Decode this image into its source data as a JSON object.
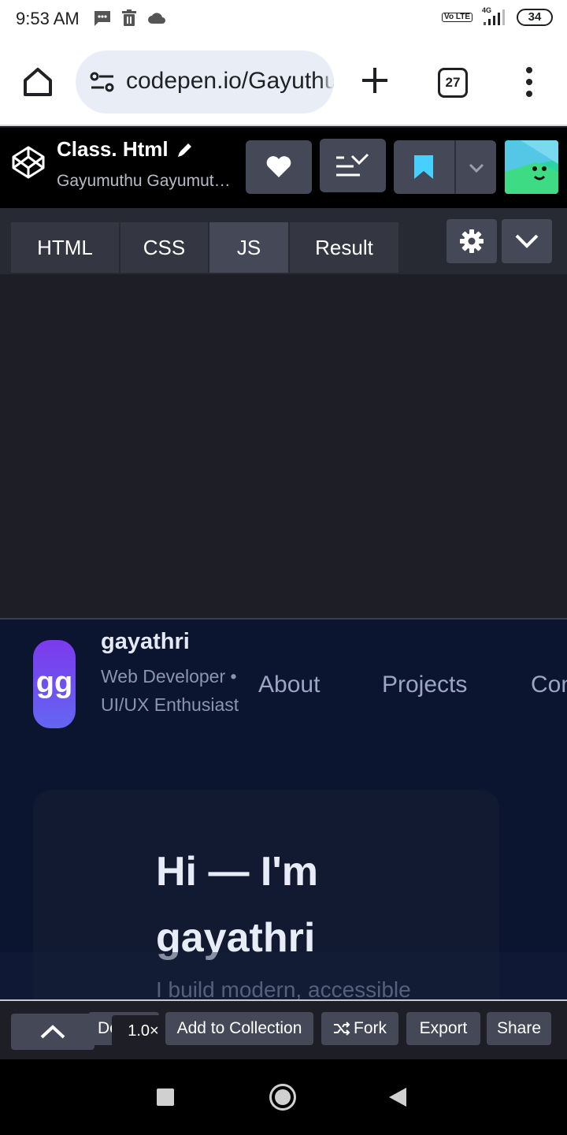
{
  "status_bar": {
    "time": "9:53 AM",
    "network": "4G",
    "volte": "Vo LTE",
    "battery": "34"
  },
  "browser": {
    "url": "codepen.io/Gayuthu",
    "tab_count": "27"
  },
  "codepen_header": {
    "title": "Class. Html",
    "author": "Gayumuthu Gayumuthu"
  },
  "editor_tabs": [
    "HTML",
    "CSS",
    "JS",
    "Result"
  ],
  "active_tab": "JS",
  "preview": {
    "logo_text": "gg",
    "name": "gayathri",
    "tagline": "Web Developer • UI/UX Enthusiast",
    "nav": [
      "About",
      "Projects",
      "Contact"
    ],
    "hero_title": "Hi — I'm gayathri",
    "hero_subtitle": "I build modern, accessible"
  },
  "toolbar": {
    "delete_label": "Delete",
    "zoom": "1.0×",
    "add_to_collection": "Add to Collection",
    "fork": "Fork",
    "export": "Export",
    "share": "Share"
  },
  "colors": {
    "codepen_header_bg": "#000000",
    "button_bg": "#444857",
    "editor_bg": "#1e1f26",
    "preview_bg": "#0c1530",
    "logo_gradient_start": "#7c3aed",
    "logo_gradient_end": "#6366f1",
    "bookmark_accent": "#47cfff"
  }
}
